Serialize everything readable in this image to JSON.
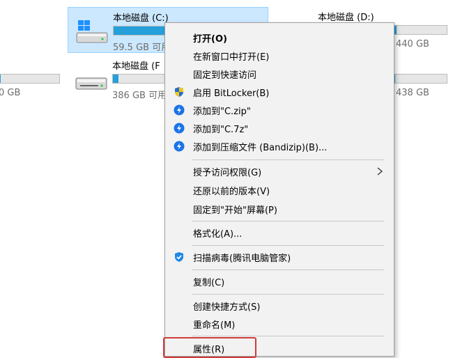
{
  "drives": [
    {
      "id": "c",
      "name": "本地磁盘 (C:)",
      "size": "59.5 GB 可用",
      "fill": 0.82,
      "selected": true
    },
    {
      "id": "d",
      "name": "本地磁盘 (D:)",
      "size": "440 GB",
      "fill": 0.08,
      "selected": false
    },
    {
      "id": "f",
      "name": "本地磁盘 (F",
      "size": "386 GB 可用",
      "fill": 0.1,
      "selected": false
    },
    {
      "id": "g",
      "name": "",
      "size": "438 GB",
      "fill": 0.05,
      "selected": false
    },
    {
      "id": "e",
      "name": "",
      "size": "0 GB",
      "fill": 0.05,
      "selected": false
    }
  ],
  "menu": {
    "open": "打开(O)",
    "open_new_window": "在新窗口中打开(E)",
    "pin_quick_access": "固定到快速访问",
    "bitlocker": "启用 BitLocker(B)",
    "add_zip": "添加到\"C.zip\"",
    "add_7z": "添加到\"C.7z\"",
    "add_archive": "添加到压缩文件 (Bandizip)(B)...",
    "grant_access": "授予访问权限(G)",
    "restore_versions": "还原以前的版本(V)",
    "pin_start": "固定到\"开始\"屏幕(P)",
    "format": "格式化(A)...",
    "scan_virus": "扫描病毒(腾讯电脑管家)",
    "copy": "复制(C)",
    "create_shortcut": "创建快捷方式(S)",
    "rename": "重命名(M)",
    "properties": "属性(R)"
  },
  "colors": {
    "accent": "#26a0da",
    "selection": "#cce8ff",
    "highlight_box": "#d23b3b"
  }
}
